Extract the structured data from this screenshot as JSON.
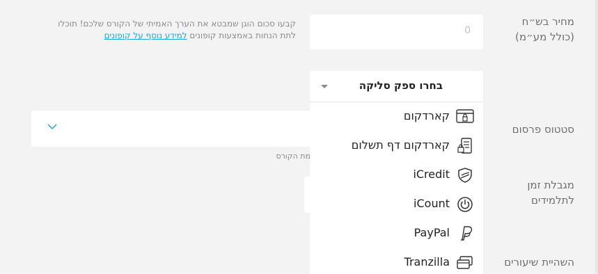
{
  "price": {
    "label": "מחיר בש״ח (כולל מע״מ)",
    "value": "0",
    "help_text": "קבעו סכום הוגן שמבטא את הערך האמיתי של הקורס שלכם! תוכלו לתת הנחות באמצעות קופונים",
    "help_link": "למידע נוסף על קופונים"
  },
  "clearing": {
    "placeholder": "בחרו ספק סליקה",
    "options": [
      {
        "label": "קארדקום",
        "icon": "card-terminal-icon"
      },
      {
        "label": "קארדקום דף תשלום",
        "icon": "payment-page-icon"
      },
      {
        "label": "iCredit",
        "icon": "shield-check-icon"
      },
      {
        "label": "iCount",
        "icon": "power-circle-icon"
      },
      {
        "label": "PayPal",
        "icon": "paypal-icon"
      },
      {
        "label": "Tranzilla",
        "icon": "cards-stack-icon"
      }
    ]
  },
  "publish_status": {
    "label": "סטטוס פרסום",
    "note": "מת הקורס"
  },
  "time_limit": {
    "label": "מגבלת זמן לתלמידים"
  },
  "lesson_delay": {
    "label": "השהיית שיעורים"
  }
}
